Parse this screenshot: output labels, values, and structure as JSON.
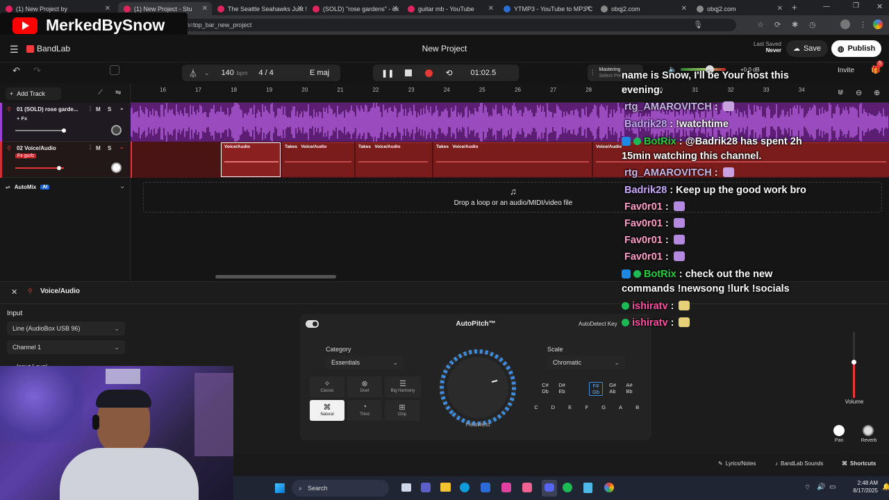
{
  "browser": {
    "tabs": [
      {
        "label": "(1) New Project by",
        "color": "#e0245e"
      },
      {
        "label": "(1) New Project - Stu",
        "color": "#e0245e"
      },
      {
        "label": "The Seattle Seahawks Just !",
        "color": "#e0245e"
      },
      {
        "label": "(SOLD) \"rose gardens\" - uk",
        "color": "#e0245e"
      },
      {
        "label": "guitar mb - YouTube",
        "color": "#e0245e"
      },
      {
        "label": "YTMP3 - YouTube to MP3 C",
        "color": "#2b6fd6"
      },
      {
        "label": "obqj2.com",
        "color": "#888888"
      },
      {
        "label": "obqj2.com",
        "color": "#888888"
      }
    ],
    "url": "n=top_bar_new_project"
  },
  "stream_logo": "MerkedBySnow",
  "app": {
    "brand": "BandLab",
    "project_title": "New Project",
    "last_saved_label": "Last Saved",
    "last_saved_value": "Never",
    "save_label": "Save",
    "publish_label": "Publish",
    "invite_label": "Invite",
    "notif_count": "5",
    "tempo_value": "140",
    "tempo_unit": "bpm",
    "time_sig": "4 / 4",
    "key": "E maj",
    "time": "01:02.5",
    "mastering_label": "Mastering",
    "mastering_sub": "Select Preset",
    "master_db": "+0.0 dB",
    "add_track_label": "Add Track"
  },
  "ruler": [
    "16",
    "17",
    "18",
    "19",
    "20",
    "21",
    "22",
    "23",
    "24",
    "25",
    "26",
    "27",
    "28",
    "29",
    "30",
    "31",
    "32",
    "33",
    "34"
  ],
  "tracks": [
    {
      "name": "01  (SOLD) rose garde...",
      "fx": "+ Fx",
      "m": "M",
      "s": "S"
    },
    {
      "name": "02  Voice/Audio",
      "fx": "Fx gurb",
      "m": "M",
      "s": "S"
    }
  ],
  "automix": {
    "label": "AutoMix",
    "ai": "AI"
  },
  "clips": {
    "voice": "Voice/Audio",
    "takes": "Takes"
  },
  "drop_text": "Drop a loop or an audio/MIDI/video file",
  "lower": {
    "track_title": "Voice/Audio",
    "input_label": "Input",
    "input_device": "Line (AudioBox USB 96)",
    "channel": "Channel 1",
    "input_level": "Input Level",
    "autopitch": "AutoPitch™",
    "autodetect": "AutoDetect Key",
    "category_label": "Category",
    "category_value": "Essentials",
    "scale_label": "Scale",
    "scale_value": "Chromatic",
    "voices": [
      "Classic",
      "Duet",
      "Big Harmony",
      "Natural",
      "Third",
      "Chip"
    ],
    "knob_label": "Heaviest",
    "keys_top": [
      "C# Db",
      "D# Eb",
      "F# Gb",
      "G# Ab",
      "A# Bb"
    ],
    "keys_bottom": [
      "C",
      "D",
      "E",
      "F",
      "G",
      "A",
      "B"
    ],
    "volume_label": "Volume",
    "pan_label": "Pan",
    "reverb_label": "Reverb",
    "lyrics_label": "Lyrics/Notes",
    "sounds_label": "BandLab Sounds",
    "shortcuts_label": "Shortcuts"
  },
  "chat": [
    {
      "user": "",
      "text": "name is Snow, I'll be Your host this",
      "ucolor": "#ffffff"
    },
    {
      "user": "",
      "text": "evening.",
      "ucolor": "#ffffff"
    },
    {
      "user": "rtg_AMAROVITCH",
      "text": " : ",
      "ucolor": "#c9b8e8"
    },
    {
      "user": "Badrik28",
      "text": " : !watchtime",
      "ucolor": "#c9a8ff"
    },
    {
      "user": "BotRix",
      "text": " : @Badrik28 has spent 2h",
      "ucolor": "#2ecc40"
    },
    {
      "user": "",
      "text": "15min watching this channel.",
      "ucolor": "#ffffff"
    },
    {
      "user": "rtg_AMAROVITCH",
      "text": " : ",
      "ucolor": "#c9b8e8"
    },
    {
      "user": "Badrik28",
      "text": " : Keep up the good work bro",
      "ucolor": "#c9a8ff"
    },
    {
      "user": "Fav0r01",
      "text": " : ",
      "ucolor": "#ff9fc8"
    },
    {
      "user": "Fav0r01",
      "text": " : ",
      "ucolor": "#ff9fc8"
    },
    {
      "user": "Fav0r01",
      "text": " : ",
      "ucolor": "#ff9fc8"
    },
    {
      "user": "Fav0r01",
      "text": " : ",
      "ucolor": "#ff9fc8"
    },
    {
      "user": "BotRix",
      "text": " : check out the new",
      "ucolor": "#2ecc40"
    },
    {
      "user": "",
      "text": "commands !newsong !lurk !socials",
      "ucolor": "#ffffff"
    },
    {
      "user": "ishiratv",
      "text": " : ",
      "ucolor": "#ff4fa3"
    },
    {
      "user": "ishiratv",
      "text": " : ",
      "ucolor": "#ff4fa3"
    }
  ],
  "taskbar": {
    "search": "Search",
    "time": "2:48 AM",
    "date": "8/17/2025"
  }
}
